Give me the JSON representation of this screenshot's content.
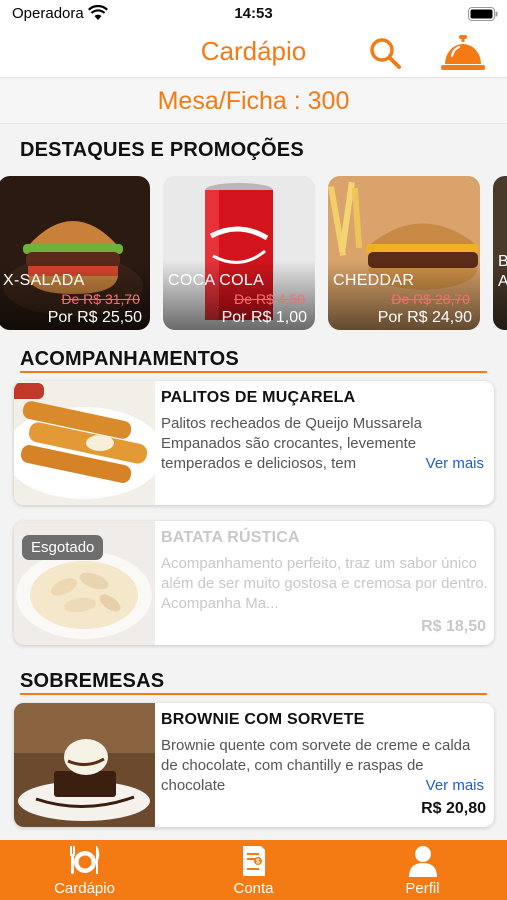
{
  "status": {
    "carrier": "Operadora",
    "time": "14:53"
  },
  "header": {
    "title": "Cardápio"
  },
  "table": {
    "label": "Mesa/Ficha : 300"
  },
  "highlights": {
    "title": "DESTAQUES E PROMOÇÕES",
    "items": [
      {
        "name": "X-SALADA",
        "old_price": "De R$ 31,70",
        "new_price": "Por R$ 25,50"
      },
      {
        "name": "COCA COLA",
        "old_price": "De R$ 4,50",
        "new_price": "Por R$ 1,00"
      },
      {
        "name": "CHEDDAR",
        "old_price": "De R$ 28,70",
        "new_price": "Por R$ 24,90"
      },
      {
        "name": "B A"
      }
    ]
  },
  "sides": {
    "title": "ACOMPANHAMENTOS",
    "items": [
      {
        "name": "PALITOS DE MUÇARELA",
        "description": "Palitos recheados de Queijo Mussarela Empanados são crocantes, levemente temperados e deliciosos, tem",
        "more": "Ver mais"
      },
      {
        "name": "BATATA RÚSTICA",
        "description": "Acompanhamento perfeito, traz um sabor único além de ser muito gostosa e cremosa por dentro. Acompanha Ma...",
        "price": "R$ 18,50",
        "badge": "Esgotado"
      }
    ]
  },
  "desserts": {
    "title": "SOBREMESAS",
    "items": [
      {
        "name": "BROWNIE COM SORVETE",
        "description": "Brownie quente com sorvete de creme e calda de chocolate, com chantilly e raspas de chocolate",
        "more": "Ver mais",
        "price": "R$ 20,80"
      }
    ]
  },
  "tabs": [
    {
      "label": "Cardápio",
      "icon": "cutlery-plate-icon"
    },
    {
      "label": "Conta",
      "icon": "bill-icon"
    },
    {
      "label": "Perfil",
      "icon": "user-icon"
    }
  ],
  "colors": {
    "accent": "#f47a14",
    "link": "#1a5fd1",
    "old_price": "#ff6b6b"
  }
}
